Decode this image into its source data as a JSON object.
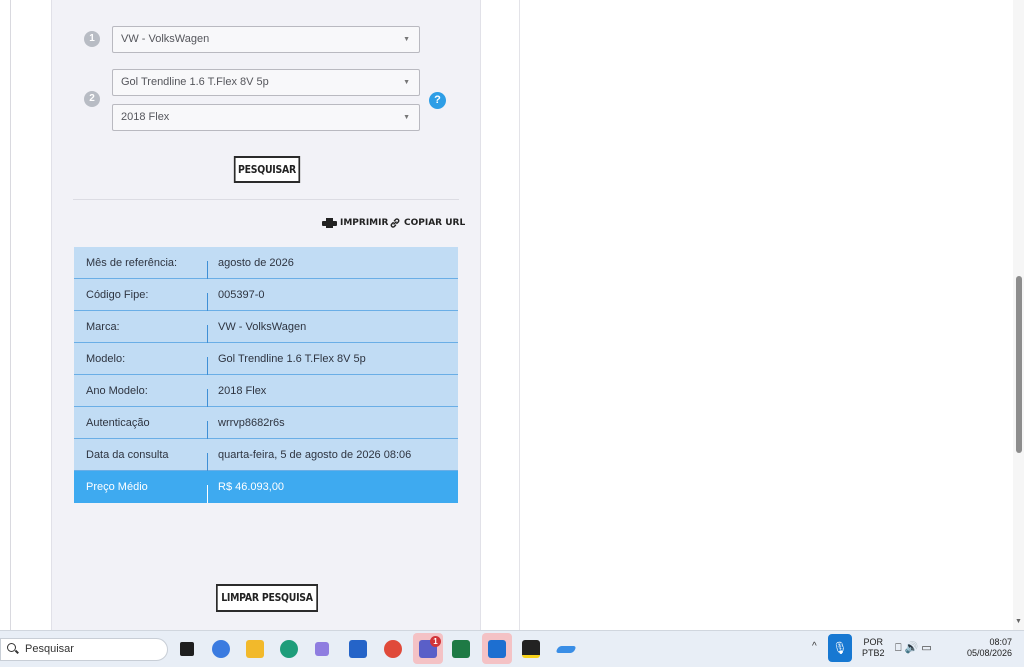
{
  "form": {
    "step1": "1",
    "step2": "2",
    "brand_select": "VW - VolksWagen",
    "model_select": "Gol Trendline 1.6 T.Flex 8V 5p",
    "year_select": "2018 Flex",
    "help_glyph": "?",
    "search_button": "PESQUISAR"
  },
  "actions": {
    "print": "IMPRIMIR",
    "copy_url": "COPIAR URL"
  },
  "result": {
    "rows": [
      {
        "label": "Mês de referência:",
        "value": "agosto de 2026"
      },
      {
        "label": "Código Fipe:",
        "value": "005397-0"
      },
      {
        "label": "Marca:",
        "value": "VW - VolksWagen"
      },
      {
        "label": "Modelo:",
        "value": "Gol Trendline 1.6 T.Flex 8V 5p"
      },
      {
        "label": "Ano Modelo:",
        "value": "2018 Flex"
      },
      {
        "label": "Autenticação",
        "value": "wrrvp8682r6s"
      },
      {
        "label": "Data da consulta",
        "value": "quarta-feira, 5 de agosto de 2026 08:06"
      }
    ],
    "price_label": "Preço Médio",
    "price_value": "R$ 46.093,00"
  },
  "clear_button": "LIMPAR PESQUISA",
  "taskbar": {
    "search_placeholder": "Pesquisar",
    "teams_badge": "1",
    "lang_line1": "POR",
    "lang_line2": "PTB2",
    "time": "08:07",
    "date": "05/08/2026"
  },
  "colors": {
    "row_bg": "#c1dcf4",
    "highlight_bg": "#3eaaf0",
    "help_blue": "#2e9ee6"
  }
}
